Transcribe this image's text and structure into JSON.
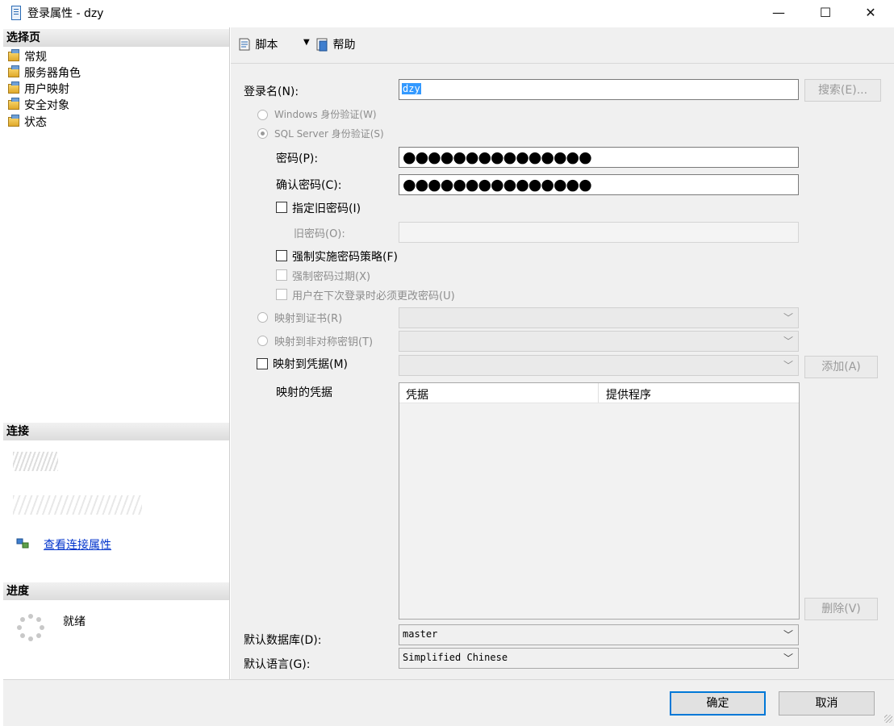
{
  "window": {
    "title": "登录属性 - dzy",
    "controls": [
      "—",
      "☐",
      "✕"
    ]
  },
  "left": {
    "select_page_header": "选择页",
    "nav_items": [
      "常规",
      "服务器角色",
      "用户映射",
      "安全对象",
      "状态"
    ],
    "connection_header": "连接",
    "view_connection_link": "查看连接属性",
    "progress_header": "进度",
    "progress_status": "就绪"
  },
  "toolbar": {
    "script_label": "脚本",
    "help_label": "帮助"
  },
  "form": {
    "login_name_label": "登录名(N):",
    "login_name_value": "dzy",
    "search_button": "搜索(E)...",
    "windows_auth": "Windows 身份验证(W)",
    "sql_auth": "SQL Server 身份验证(S)",
    "password_label": "密码(P):",
    "password_value": "●●●●●●●●●●●●●●●",
    "confirm_label": "确认密码(C):",
    "confirm_value": "●●●●●●●●●●●●●●●",
    "old_password_chk": "指定旧密码(I)",
    "old_password_label": "旧密码(O):",
    "enforce_policy": "强制实施密码策略(F)",
    "enforce_expiration": "强制密码过期(X)",
    "must_change": "用户在下次登录时必须更改密码(U)",
    "map_cert": "映射到证书(R)",
    "map_asym": "映射到非对称密钥(T)",
    "map_cred": "映射到凭据(M)",
    "add_button": "添加(A)",
    "mapped_cred_label": "映射的凭据",
    "cred_columns": [
      "凭据",
      "提供程序"
    ],
    "remove_button": "删除(V)",
    "default_db_label": "默认数据库(D):",
    "default_db_value": "master",
    "default_lang_label": "默认语言(G):",
    "default_lang_value": "Simplified Chinese"
  },
  "bottom": {
    "ok_button": "确定",
    "cancel_button": "取消"
  }
}
